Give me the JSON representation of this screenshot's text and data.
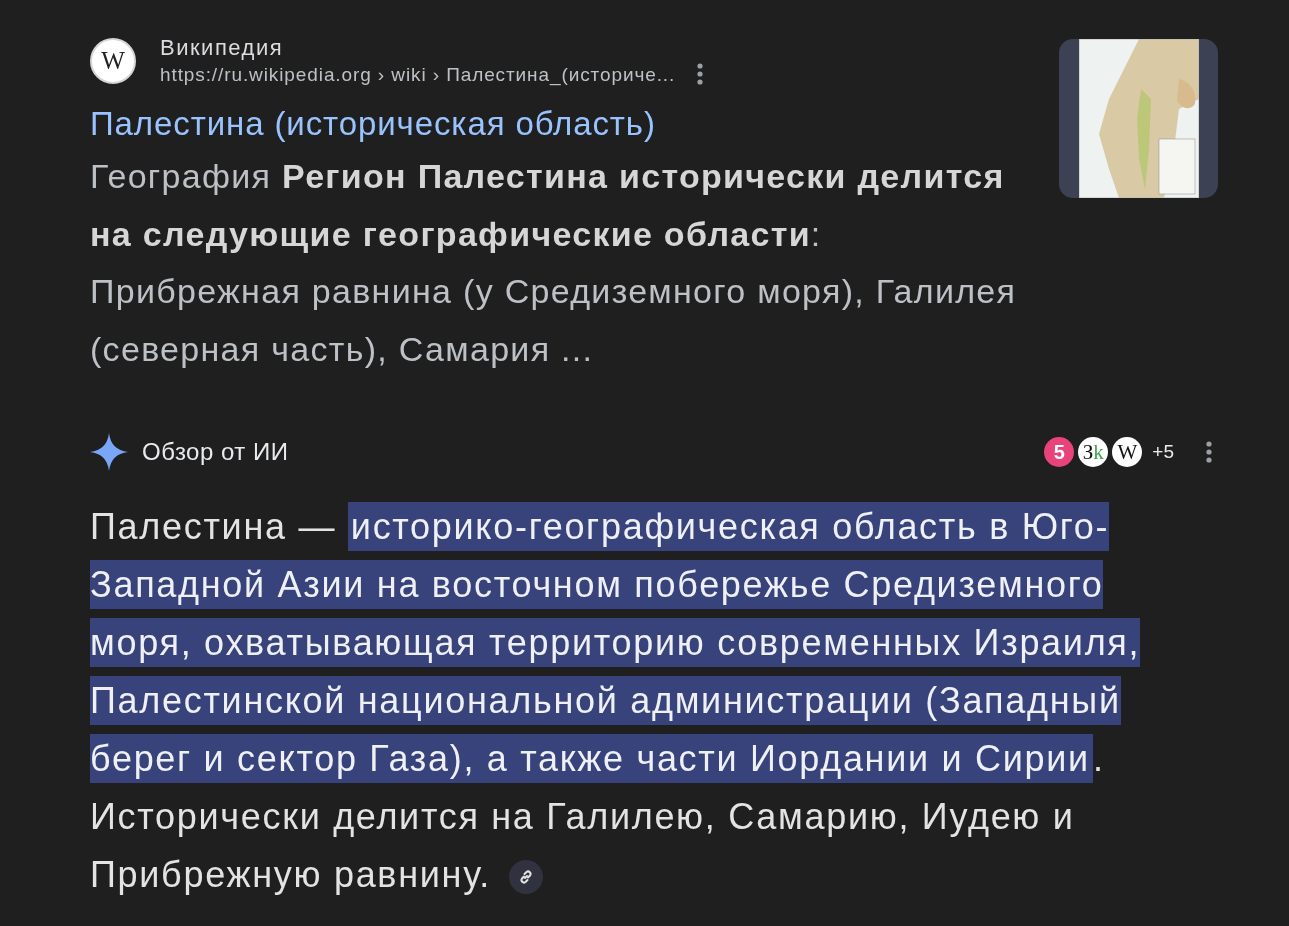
{
  "result": {
    "site_logo_letter": "W",
    "site_name": "Википедия",
    "url": "https://ru.wikipedia.org › wiki › Палестина_(историче...",
    "title": "Палестина (историческая область)",
    "snippet": "География **Регион Палестина исторически делится на следующие географические области**: Прибрежная равнина (у Средиземного моря), Галилея (северная часть), Самария ..."
  },
  "ai_overview": {
    "label": "Обзор от ИИ",
    "sources": [
      {
        "kind": "badge",
        "text": "5",
        "color": "#e8437a"
      },
      {
        "kind": "letters",
        "letters": [
          {
            "text": "З",
            "color": "#111111"
          },
          {
            "text": "k",
            "color": "#3fa34d"
          }
        ]
      },
      {
        "kind": "letters",
        "letters": [
          {
            "text": "W",
            "color": "#111111"
          }
        ]
      }
    ],
    "more_sources": "+5",
    "segments": [
      {
        "text": "Палестина — ",
        "highlighted": false
      },
      {
        "text": "историко-географическая область в Юго-Западной Азии на восточном побережье Средиземного моря, охватывающая территорию современных Израиля, Палестинской национальной администрации (Западный берег и сектор Газа), а также части Иордании и Сирии",
        "highlighted": true
      },
      {
        "text": ". Исторически делится на Галилею, Самарию, Иудею и Прибрежную равнину.",
        "highlighted": false
      }
    ]
  }
}
